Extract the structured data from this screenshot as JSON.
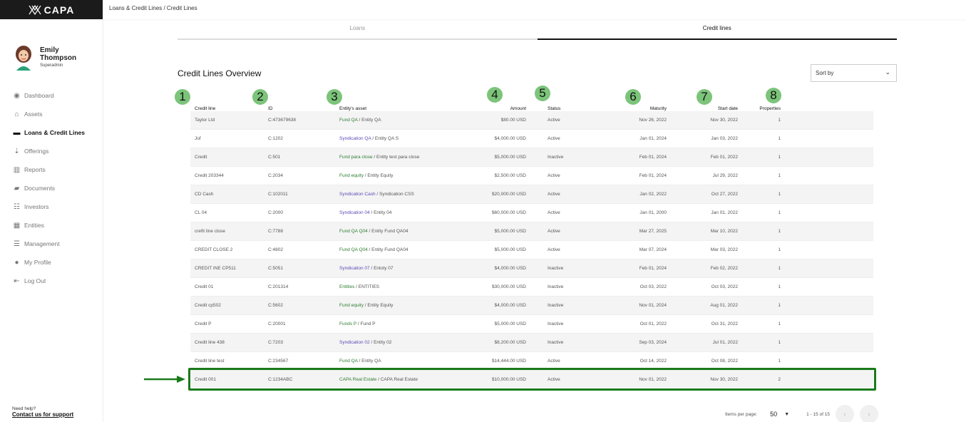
{
  "app": {
    "logo_text": "CAPA",
    "breadcrumb": "Loans & Credit Lines / Credit Lines"
  },
  "user": {
    "first_name": "Emily",
    "last_name": "Thompson",
    "role": "Superadmin"
  },
  "sidebar": {
    "items": [
      {
        "label": "Dashboard",
        "icon": "dashboard-icon",
        "glyph": "◉",
        "active": false
      },
      {
        "label": "Assets",
        "icon": "home-icon",
        "glyph": "⌂",
        "active": false
      },
      {
        "label": "Loans & Credit Lines",
        "icon": "credit-card-icon",
        "glyph": "▬",
        "active": true
      },
      {
        "label": "Offerings",
        "icon": "offerings-icon",
        "glyph": "⇣",
        "active": false
      },
      {
        "label": "Reports",
        "icon": "bar-chart-icon",
        "glyph": "▥",
        "active": false
      },
      {
        "label": "Documents",
        "icon": "folder-icon",
        "glyph": "▰",
        "active": false
      },
      {
        "label": "Investors",
        "icon": "people-icon",
        "glyph": "☷",
        "active": false
      },
      {
        "label": "Entities",
        "icon": "grid-icon",
        "glyph": "▦",
        "active": false
      },
      {
        "label": "Management",
        "icon": "checklist-icon",
        "glyph": "☰",
        "active": false
      },
      {
        "label": "My Profile",
        "icon": "user-circle-icon",
        "glyph": "●",
        "active": false
      },
      {
        "label": "Log Out",
        "icon": "logout-icon",
        "glyph": "⇤",
        "active": false
      }
    ],
    "support_prompt": "Need help?",
    "support_link": "Contact us for support"
  },
  "tabs": [
    {
      "label": "Loans",
      "active": false
    },
    {
      "label": "Credit lines",
      "active": true
    }
  ],
  "main": {
    "title": "Credit Lines Overview",
    "sort_label": "Sort by"
  },
  "markers": [
    "1",
    "2",
    "3",
    "4",
    "5",
    "6",
    "7",
    "8"
  ],
  "table": {
    "headers": [
      "Credit line",
      "ID",
      "Entity's asset",
      "Amount",
      "Status",
      "Maturity",
      "Start date",
      "Properties"
    ],
    "rows": [
      {
        "name": "Taylor Ltd",
        "id": "C:473679638",
        "asset": "Fund QA",
        "entity": "Entity QA",
        "asset_color": "green",
        "amount": "$80.00 USD",
        "status": "Active",
        "maturity": "Nov 26, 2022",
        "start": "Nov 30, 2022",
        "props": "1"
      },
      {
        "name": "Jof",
        "id": "C:1202",
        "asset": "Syndication QA",
        "entity": "Entity QA S",
        "asset_color": "purple",
        "amount": "$4,000.00 USD",
        "status": "Active",
        "maturity": "Jan 01, 2024",
        "start": "Jan 03, 2022",
        "props": "1"
      },
      {
        "name": "Credit",
        "id": "C:501",
        "asset": "Fund para close",
        "entity": "Entity test para close",
        "asset_color": "green",
        "amount": "$5,000.00 USD",
        "status": "Inactive",
        "maturity": "Feb 01, 2024",
        "start": "Feb 01, 2022",
        "props": "1"
      },
      {
        "name": "Credit 203344",
        "id": "C:2034",
        "asset": "Fund equity",
        "entity": "Entity Equity",
        "asset_color": "green",
        "amount": "$2,500.00 USD",
        "status": "Active",
        "maturity": "Feb 01, 2024",
        "start": "Jul 29, 2022",
        "props": "1"
      },
      {
        "name": "CD Cash",
        "id": "C:102011",
        "asset": "Syndication Cash",
        "entity": "Syndication CSS",
        "asset_color": "purple",
        "amount": "$20,000.00 USD",
        "status": "Active",
        "maturity": "Jan 02, 2022",
        "start": "Oct 27, 2022",
        "props": "1"
      },
      {
        "name": "CL 04",
        "id": "C:2000",
        "asset": "Syndication 04",
        "entity": "Entity 04",
        "asset_color": "purple",
        "amount": "$60,000.00 USD",
        "status": "Active",
        "maturity": "Jan 01, 2000",
        "start": "Jan 01, 2022",
        "props": "1"
      },
      {
        "name": "crefit line close",
        "id": "C:7788",
        "asset": "Fund QA Q04",
        "entity": "Entity Fund QA04",
        "asset_color": "green",
        "amount": "$5,000.00 USD",
        "status": "Active",
        "maturity": "Mar 27, 2025",
        "start": "Mar 10, 2022",
        "props": "1"
      },
      {
        "name": "CREDIT CLOSE 2",
        "id": "C:4802",
        "asset": "Fund QA Q04",
        "entity": "Entity Fund QA04",
        "asset_color": "green",
        "amount": "$5,000.00 USD",
        "status": "Active",
        "maturity": "Mar 07, 2024",
        "start": "Mar 03, 2022",
        "props": "1"
      },
      {
        "name": "CREDIT INE CP511",
        "id": "C:5051",
        "asset": "Syndication 07",
        "entity": "Entoty 07",
        "asset_color": "purple",
        "amount": "$4,000.00 USD",
        "status": "Inactive",
        "maturity": "Feb 01, 2024",
        "start": "Feb 02, 2022",
        "props": "1"
      },
      {
        "name": "Credit 01",
        "id": "C:201314",
        "asset": "Entities",
        "entity": "ENTITIES",
        "asset_color": "green",
        "amount": "$30,000.00 USD",
        "status": "Inactive",
        "maturity": "Oct 03, 2022",
        "start": "Oct 03, 2022",
        "props": "1"
      },
      {
        "name": "Credit cp502",
        "id": "C:5602",
        "asset": "Fund equity",
        "entity": "Entity Equity",
        "asset_color": "green",
        "amount": "$4,000.00 USD",
        "status": "Inactive",
        "maturity": "Nov 01, 2024",
        "start": "Aug 01, 2022",
        "props": "1"
      },
      {
        "name": "Credit P",
        "id": "C:20001",
        "asset": "Funds P",
        "entity": "Fund P",
        "asset_color": "green",
        "amount": "$5,000.00 USD",
        "status": "Inactive",
        "maturity": "Oct 01, 2022",
        "start": "Oct 31, 2022",
        "props": "1"
      },
      {
        "name": "Credit line 438",
        "id": "C:7203",
        "asset": "Syndication 02",
        "entity": "Entity 02",
        "asset_color": "purple",
        "amount": "$8,200.00 USD",
        "status": "Inactive",
        "maturity": "Sep 03, 2024",
        "start": "Jul 01, 2022",
        "props": "1"
      },
      {
        "name": "Credit line test",
        "id": "C:234567",
        "asset": "Fund QA",
        "entity": "Entity QA",
        "asset_color": "green",
        "amount": "$14,444.00 USD",
        "status": "Active",
        "maturity": "Oct 14, 2022",
        "start": "Oct 08, 2022",
        "props": "1"
      },
      {
        "name": "Credit 001",
        "id": "C:1234ABC",
        "asset": "CAPA Real Estate",
        "entity": "CAPA Real Estate",
        "asset_color": "green",
        "amount": "$10,000.00 USD",
        "status": "Active",
        "maturity": "Nov 01, 2022",
        "start": "Nov 30, 2022",
        "props": "2"
      }
    ]
  },
  "pagination": {
    "items_per_page_label": "Items per page:",
    "items_per_page": "50",
    "range": "1 - 15 of 15"
  },
  "colors": {
    "marker_fill": "#7cc47a",
    "highlight": "#1a7a1a",
    "asset_green": "#2e7d32",
    "asset_purple": "#5b4bb7"
  }
}
